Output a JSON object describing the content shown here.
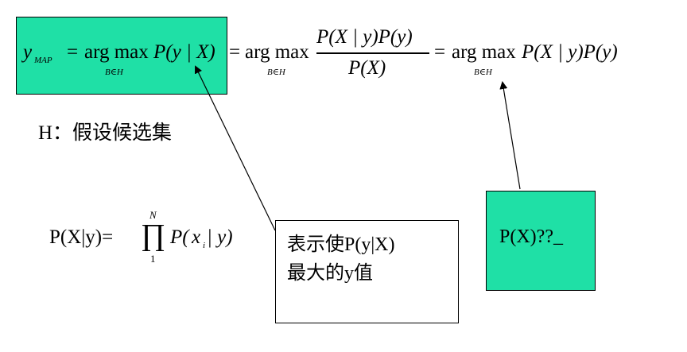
{
  "colors": {
    "highlight_fill": "#1fe0a6",
    "line": "#000000",
    "background": "#ffffff"
  },
  "formula_top": {
    "y_map_y": "y",
    "y_map_sub": "MAP",
    "eq1": "=",
    "argmax1": "arg max",
    "argmax1_sub": "B∈H",
    "expr1": "P(y | X)",
    "eq2": "=",
    "argmax2": "arg max",
    "argmax2_sub": "B∈H",
    "frac_numerator": "P(X | y)P(y)",
    "frac_denominator": "P(X)",
    "eq3": "=",
    "argmax3": "arg max",
    "argmax3_sub": "B∈H",
    "expr3": "P(X | y)P(y)"
  },
  "hypothesis_note": "H：假设候选集",
  "likelihood_formula": {
    "lhs": "P(X|y)=",
    "prod_symbol": "∏",
    "prod_upper": "N",
    "prod_lower": "1",
    "term_p": "P(",
    "term_x": "x",
    "term_x_sub": "i",
    "term_rest": " | y)"
  },
  "callout_argmax": {
    "line1": "表示使P(y|X)",
    "line2": "最大的y值"
  },
  "callout_px": {
    "text": "P(X)??_"
  }
}
